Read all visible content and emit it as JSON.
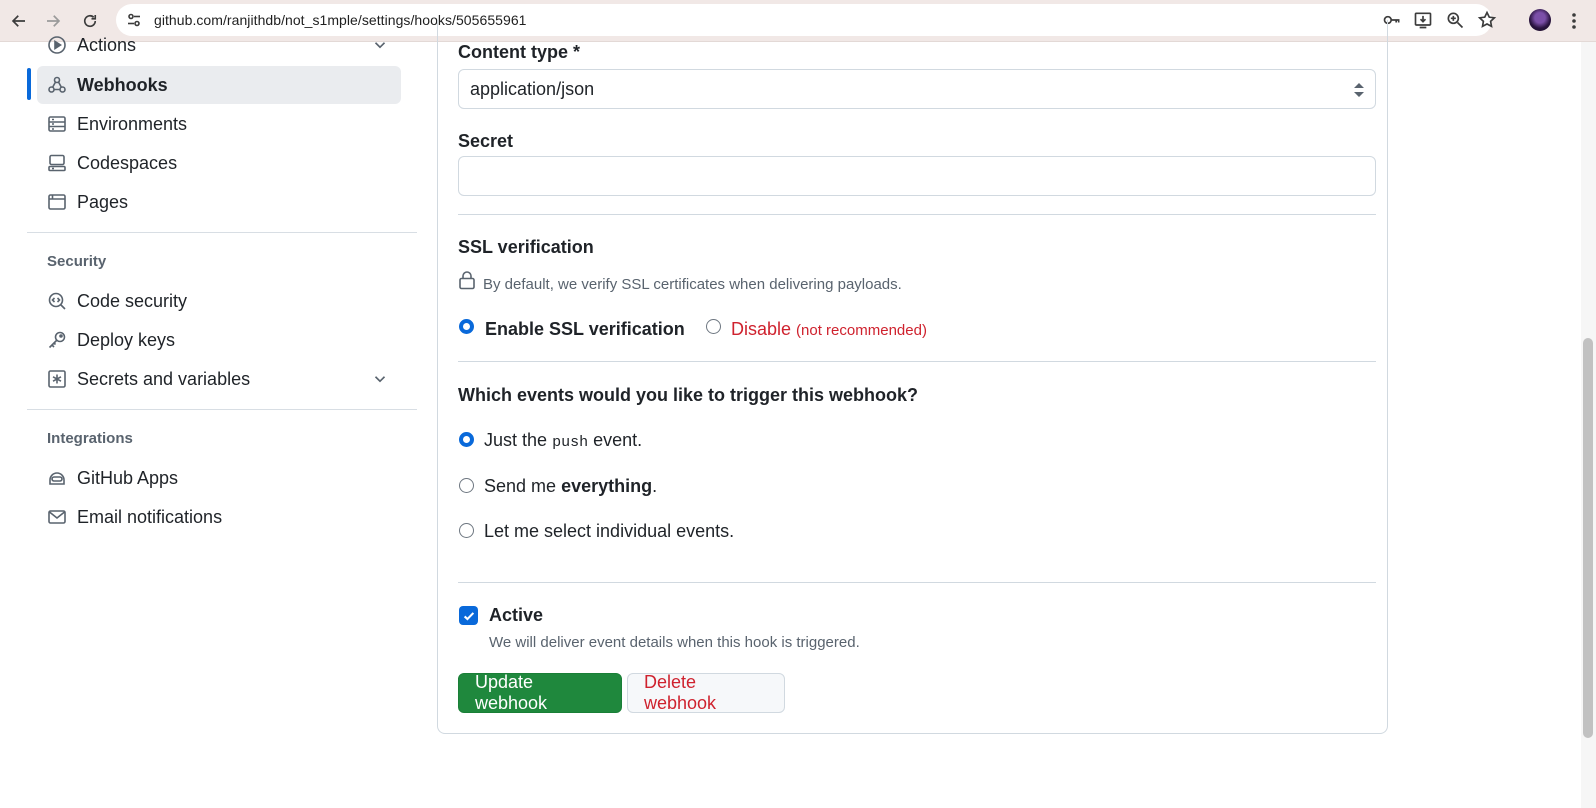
{
  "browser": {
    "url": "github.com/ranjithdb/not_s1mple/settings/hooks/505655961",
    "icons": [
      "back-arrow-icon",
      "forward-arrow-icon",
      "reload-icon",
      "site-info-icon",
      "key-icon",
      "install-icon",
      "zoom-icon",
      "star-icon",
      "profile-avatar",
      "more-icon"
    ]
  },
  "sidebar": {
    "items_top": [
      {
        "label": "Actions",
        "icon": "play-icon",
        "chevron": true
      },
      {
        "label": "Webhooks",
        "icon": "webhook-icon",
        "selected": true
      },
      {
        "label": "Environments",
        "icon": "server-icon"
      },
      {
        "label": "Codespaces",
        "icon": "codespaces-icon"
      },
      {
        "label": "Pages",
        "icon": "browser-icon"
      }
    ],
    "security_heading": "Security",
    "security_items": [
      {
        "label": "Code security",
        "icon": "codescan-icon"
      },
      {
        "label": "Deploy keys",
        "icon": "key-icon"
      },
      {
        "label": "Secrets and variables",
        "icon": "asterisk-icon",
        "chevron": true
      }
    ],
    "integrations_heading": "Integrations",
    "integration_items": [
      {
        "label": "GitHub Apps",
        "icon": "hubot-icon"
      },
      {
        "label": "Email notifications",
        "icon": "mail-icon"
      }
    ]
  },
  "form": {
    "content_type_label": "Content type *",
    "content_type_value": "application/json",
    "secret_label": "Secret",
    "secret_value": "",
    "ssl": {
      "heading": "SSL verification",
      "description": "By default, we verify SSL certificates when delivering payloads.",
      "enable_label": "Enable SSL verification",
      "disable_label": "Disable",
      "disable_note": "(not recommended)",
      "selected": "enable"
    },
    "events": {
      "question": "Which events would you like to trigger this webhook?",
      "opt_push_prefix": "Just the",
      "opt_push_code": "push",
      "opt_push_suffix": "event.",
      "opt_all_prefix": "Send me",
      "opt_all_bold": "everything",
      "opt_all_suffix": ".",
      "opt_select": "Let me select individual events.",
      "selected": "push"
    },
    "active": {
      "label": "Active",
      "checked": true,
      "description": "We will deliver event details when this hook is triggered."
    },
    "update_button": "Update webhook",
    "delete_button": "Delete webhook"
  },
  "colors": {
    "accent": "#0969da",
    "primary_button": "#1f883d",
    "danger": "#cf222e"
  }
}
